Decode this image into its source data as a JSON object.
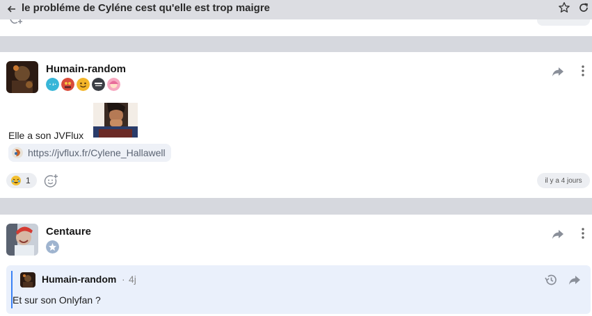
{
  "header": {
    "title": "le probléme de Cyléne cest qu'elle est trop maigre"
  },
  "colors": {
    "accent": "#3b82f6",
    "page_bg": "#d6d8de",
    "quote_bg": "#eaf0fb"
  },
  "posts": [
    {
      "author": "Humain-random",
      "badges": [
        "badge-stars",
        "badge-mask",
        "badge-smiley",
        "badge-zero-tout",
        "badge-girl"
      ],
      "text": "Elle a son JVFlux",
      "link": "https://jvflux.fr/Cylene_Hallawell",
      "reaction_count": "1",
      "date": "il y a 4 jours"
    },
    {
      "author": "Centaure",
      "badges": [
        "badge-star"
      ],
      "quote": {
        "author": "Humain-random",
        "separator": "·",
        "time": "4j",
        "text": "Et sur son Onlyfan ?"
      }
    }
  ]
}
